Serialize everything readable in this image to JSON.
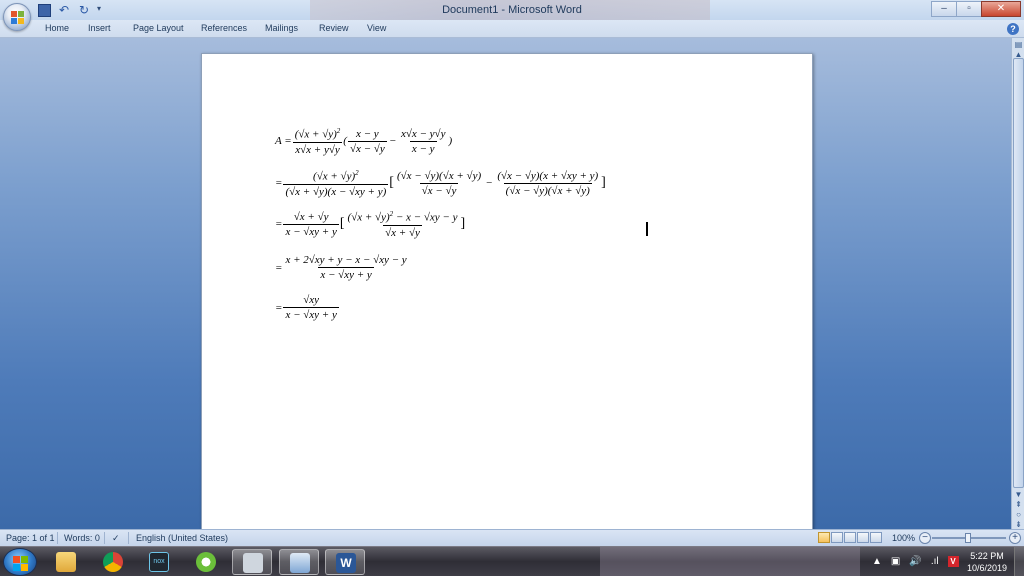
{
  "window": {
    "title": "Document1 - Microsoft Word",
    "controls": {
      "minimize": "–",
      "maximize": "▫",
      "close": "✕"
    }
  },
  "quick_access": {
    "undo": "↶",
    "redo": "↻",
    "more": "▾"
  },
  "ribbon": {
    "tabs": [
      "Home",
      "Insert",
      "Page Layout",
      "References",
      "Mailings",
      "Review",
      "View"
    ],
    "help": "?"
  },
  "document": {
    "math": {
      "l1": {
        "lhs": "A =",
        "n1": "(√x + √y)",
        "n1sup": "2",
        "d1": "x√x + y√y",
        "paren_open": "(",
        "n2": "x − y",
        "d2": "√x − √y",
        "minus": "−",
        "n3": "x√x − y√y",
        "d3": "x − y",
        "paren_close": ")"
      },
      "l2": {
        "lhs": "=",
        "n1": "(√x + √y)",
        "n1sup": "2",
        "d1": "(√x + √y)(x − √xy + y)",
        "open": "[",
        "n2": "(√x − √y)(√x + √y)",
        "d2": "√x − √y",
        "minus": "−",
        "n3": "(√x − √y)(x + √xy + y)",
        "d3": "(√x − √y)(√x + √y)",
        "close": "]"
      },
      "l3": {
        "lhs": "=",
        "n1": "√x + √y",
        "d1": "x − √xy + y",
        "open": "[",
        "n2": "(√x + √y)",
        "n2sup": "2",
        "n2tail": " − x − √xy − y",
        "d2": "√x + √y",
        "close": "]"
      },
      "l4": {
        "lhs": "=",
        "n1": "x + 2√xy + y − x − √xy − y",
        "d1": "x − √xy + y"
      },
      "l5": {
        "lhs": "=",
        "n1": "√xy",
        "d1": "x − √xy + y"
      }
    }
  },
  "status": {
    "page": "Page: 1 of 1",
    "words": "Words: 0",
    "language": "English (United States)",
    "zoom": "100%",
    "zoom_minus": "−",
    "zoom_plus": "+"
  },
  "taskbar": {
    "clock_time": "5:22 PM",
    "clock_date": "10/6/2019",
    "tray_arrow": "▲",
    "tray_volume": "🔊",
    "tray_signal": ".ıl",
    "nox": "nox",
    "word_letter": "W"
  },
  "colors": {
    "titlebar": "#d7e4f4",
    "workspace": "#5a86c0",
    "taskbar": "#3a3942"
  }
}
